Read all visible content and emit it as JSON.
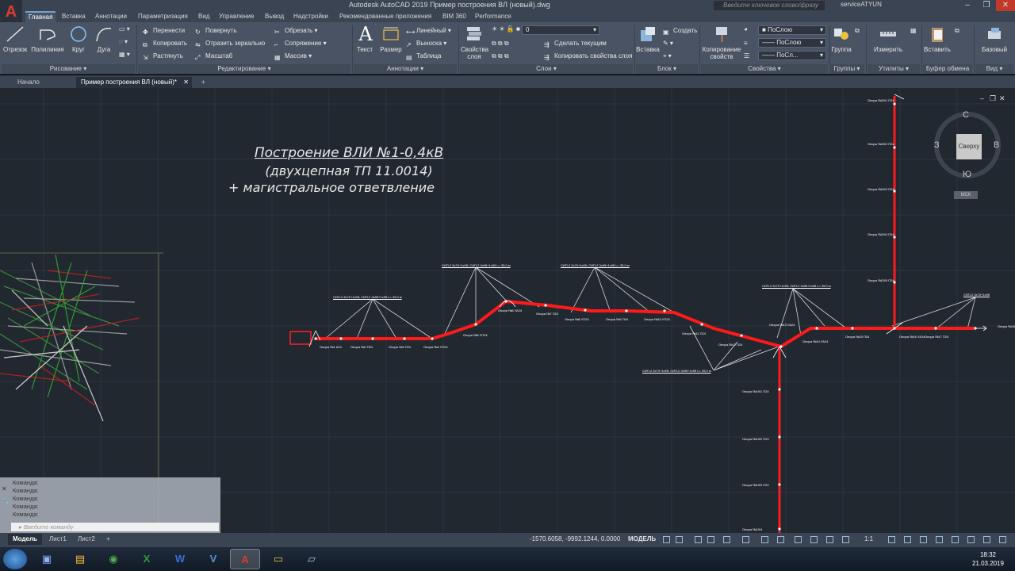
{
  "window": {
    "title": "Autodesk AutoCAD 2019    Пример построения ВЛ (новый).dwg",
    "search_placeholder": "Введите ключевое слово/фразу",
    "user": "serviceATYUN",
    "app_logo": "A"
  },
  "ribbon_tabs": [
    "Главная",
    "Вставка",
    "Аннотации",
    "Параметризация",
    "Вид",
    "Управление",
    "Вывод",
    "Надстройки",
    "Рекомендованные приложения",
    "BIM 360",
    "Performance"
  ],
  "ribbon": {
    "draw": {
      "title": "Рисование",
      "line": "Отрезок",
      "polyline": "Полилиния",
      "circle": "Круг",
      "arc": "Дуга"
    },
    "modify": {
      "title": "Редактирование",
      "move": "Перенести",
      "rotate": "Повернуть",
      "trim": "Обрезать",
      "copy": "Копировать",
      "mirror": "Отразить зеркально",
      "fillet": "Сопряжение",
      "stretch": "Растянуть",
      "scale": "Масштаб",
      "array": "Массив"
    },
    "annotation": {
      "title": "Аннотации",
      "text": "Текст",
      "dimension": "Размер",
      "linear": "Линейный",
      "leader": "Выноска",
      "table": "Таблица"
    },
    "layers": {
      "title": "Слои",
      "properties": "Свойства слоя",
      "current_layer": "0",
      "make_current": "Сделать текущим",
      "match_layer": "Копировать свойства слоя"
    },
    "block": {
      "title": "Блок",
      "insert": "Вставка",
      "create": "Создать"
    },
    "properties": {
      "title": "Свойства",
      "match": "Копирование свойств",
      "color": "ПоСлою",
      "linetype": "ПоСлою",
      "lineweight": "ПоСл..."
    },
    "groups": {
      "title": "Группы",
      "group": "Группа"
    },
    "utilities": {
      "title": "Утилиты",
      "measure": "Измерить"
    },
    "clipboard": {
      "title": "Буфер обмена",
      "paste": "Вставить"
    },
    "view": {
      "title": "Вид",
      "base": "Базовый"
    }
  },
  "file_tabs": [
    "Начало",
    "Пример построения ВЛ (новый)*"
  ],
  "drawing": {
    "title_line1": "Построение ВЛИ №1-0,4кВ",
    "title_line2": "(двухцепная ТП 11.0014)",
    "title_line3": "+ магистральное ответвление",
    "viewcube_face": "Сверху",
    "viewcube_n": "С",
    "viewcube_s": "Ю",
    "viewcube_w": "З",
    "viewcube_e": "В",
    "wcs": "МСК",
    "annotations_top": [
      "СИП-2 3х70+1х95; СИП-2 3х95+1х95 L= 35.0 м",
      "СИП-2 3х70+1х95; СИП-2 3х95+1х95 L= 35.0 м",
      "СИП-2 3х70+1х95; СИП-2 3х95+1х95 L= 35.0 м",
      "СИП-2 3х70+1х95; СИП-2 3х95+1х95 L= 35.0 м",
      "СИП-2 3х70+1х95",
      "СИП-2 3х70+1х95; СИП-2 3х95+1х95 L= 35.0 м"
    ],
    "support_labels": [
      "Опора №1 А24",
      "Опора №2 П24",
      "Опора №3 П24",
      "Опора №4 УП24",
      "Опора №5 УП24",
      "Опора №6 УА24",
      "Опора №7 П24",
      "Опора №8 УП24",
      "Опора №9 П24",
      "Опора №10 УП24",
      "Опора №11 П24",
      "Опора №12 П24",
      "Опора №13 УА24",
      "Опора №14 УА24",
      "Опора №15 П24",
      "Опора №16 УА24",
      "Опора №17 П24",
      "Опора №18"
    ],
    "branch_labels": [
      "Опора №19/1 П24",
      "Опора №19/2 П24",
      "Опора №19/3 П24",
      "Опора №19/4"
    ],
    "vertical_labels": [
      "Опора №20/1 П24",
      "Опора №20/2 П24",
      "Опора №20/3 П24",
      "Опора №20/4 П24",
      "Опора №20/5 П24",
      "Опора №20/6 П24",
      "Опора №20/7 П24",
      "Опора №20/8 П24"
    ]
  },
  "command": {
    "lines": [
      "Команда:",
      "Команда:",
      "Команда:",
      "Команда:",
      "Команда:"
    ],
    "placeholder": "Введите команду"
  },
  "layout_tabs": [
    "Модель",
    "Лист1",
    "Лист2"
  ],
  "status": {
    "coords": "-1570.6058, -9992.1244, 0.0000",
    "space": "МОДЕЛЬ",
    "scale": "1:1"
  },
  "taskbar": {
    "time": "18:32",
    "date": "21.03.2019"
  },
  "colors": {
    "ribbon_bg": "#4a5363",
    "canvas_bg": "#212830",
    "line_red": "#ff1a1a",
    "accent_blue": "#6ea4ce"
  }
}
